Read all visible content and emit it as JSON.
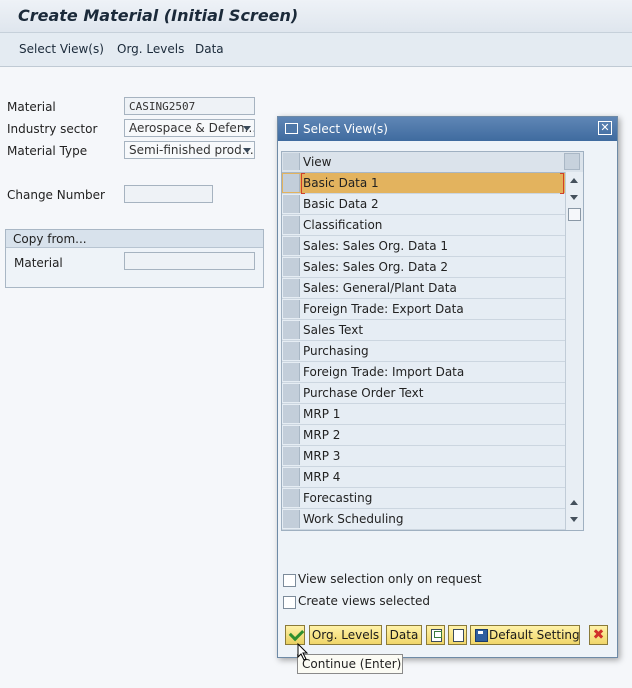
{
  "window": {
    "title": "Create Material (Initial Screen)"
  },
  "menu": [
    "Select View(s)",
    "Org. Levels",
    "Data"
  ],
  "form": {
    "material_label": "Material",
    "material_value": "CASING2507",
    "industry_label": "Industry sector",
    "industry_value": "Aerospace & Defen…",
    "type_label": "Material Type",
    "type_value": "Semi-finished prod…",
    "change_label": "Change Number",
    "change_value": "",
    "copy_group_title": "Copy from...",
    "copy_material_label": "Material",
    "copy_material_value": ""
  },
  "dialog": {
    "title": "Select View(s)",
    "column_header": "View",
    "selected_view": "Basic Data 1",
    "views": [
      "Basic Data 1",
      "Basic Data 2",
      "Classification",
      "Sales: Sales Org. Data 1",
      "Sales: Sales Org. Data 2",
      "Sales: General/Plant Data",
      "Foreign Trade: Export Data",
      "Sales Text",
      "Purchasing",
      "Foreign Trade: Import Data",
      "Purchase Order Text",
      "MRP 1",
      "MRP 2",
      "MRP 3",
      "MRP 4",
      "Forecasting",
      "Work Scheduling"
    ],
    "option_on_request": "View selection only on request",
    "option_create_selected": "Create views selected",
    "buttons": {
      "org_levels": "Org. Levels",
      "data": "Data",
      "default_setting": "Default Setting"
    },
    "tooltip": "Continue   (Enter)"
  },
  "colors": {
    "accent": "#e3b35e",
    "title_bar": "#4f78a9",
    "button": "#f0d66a"
  }
}
